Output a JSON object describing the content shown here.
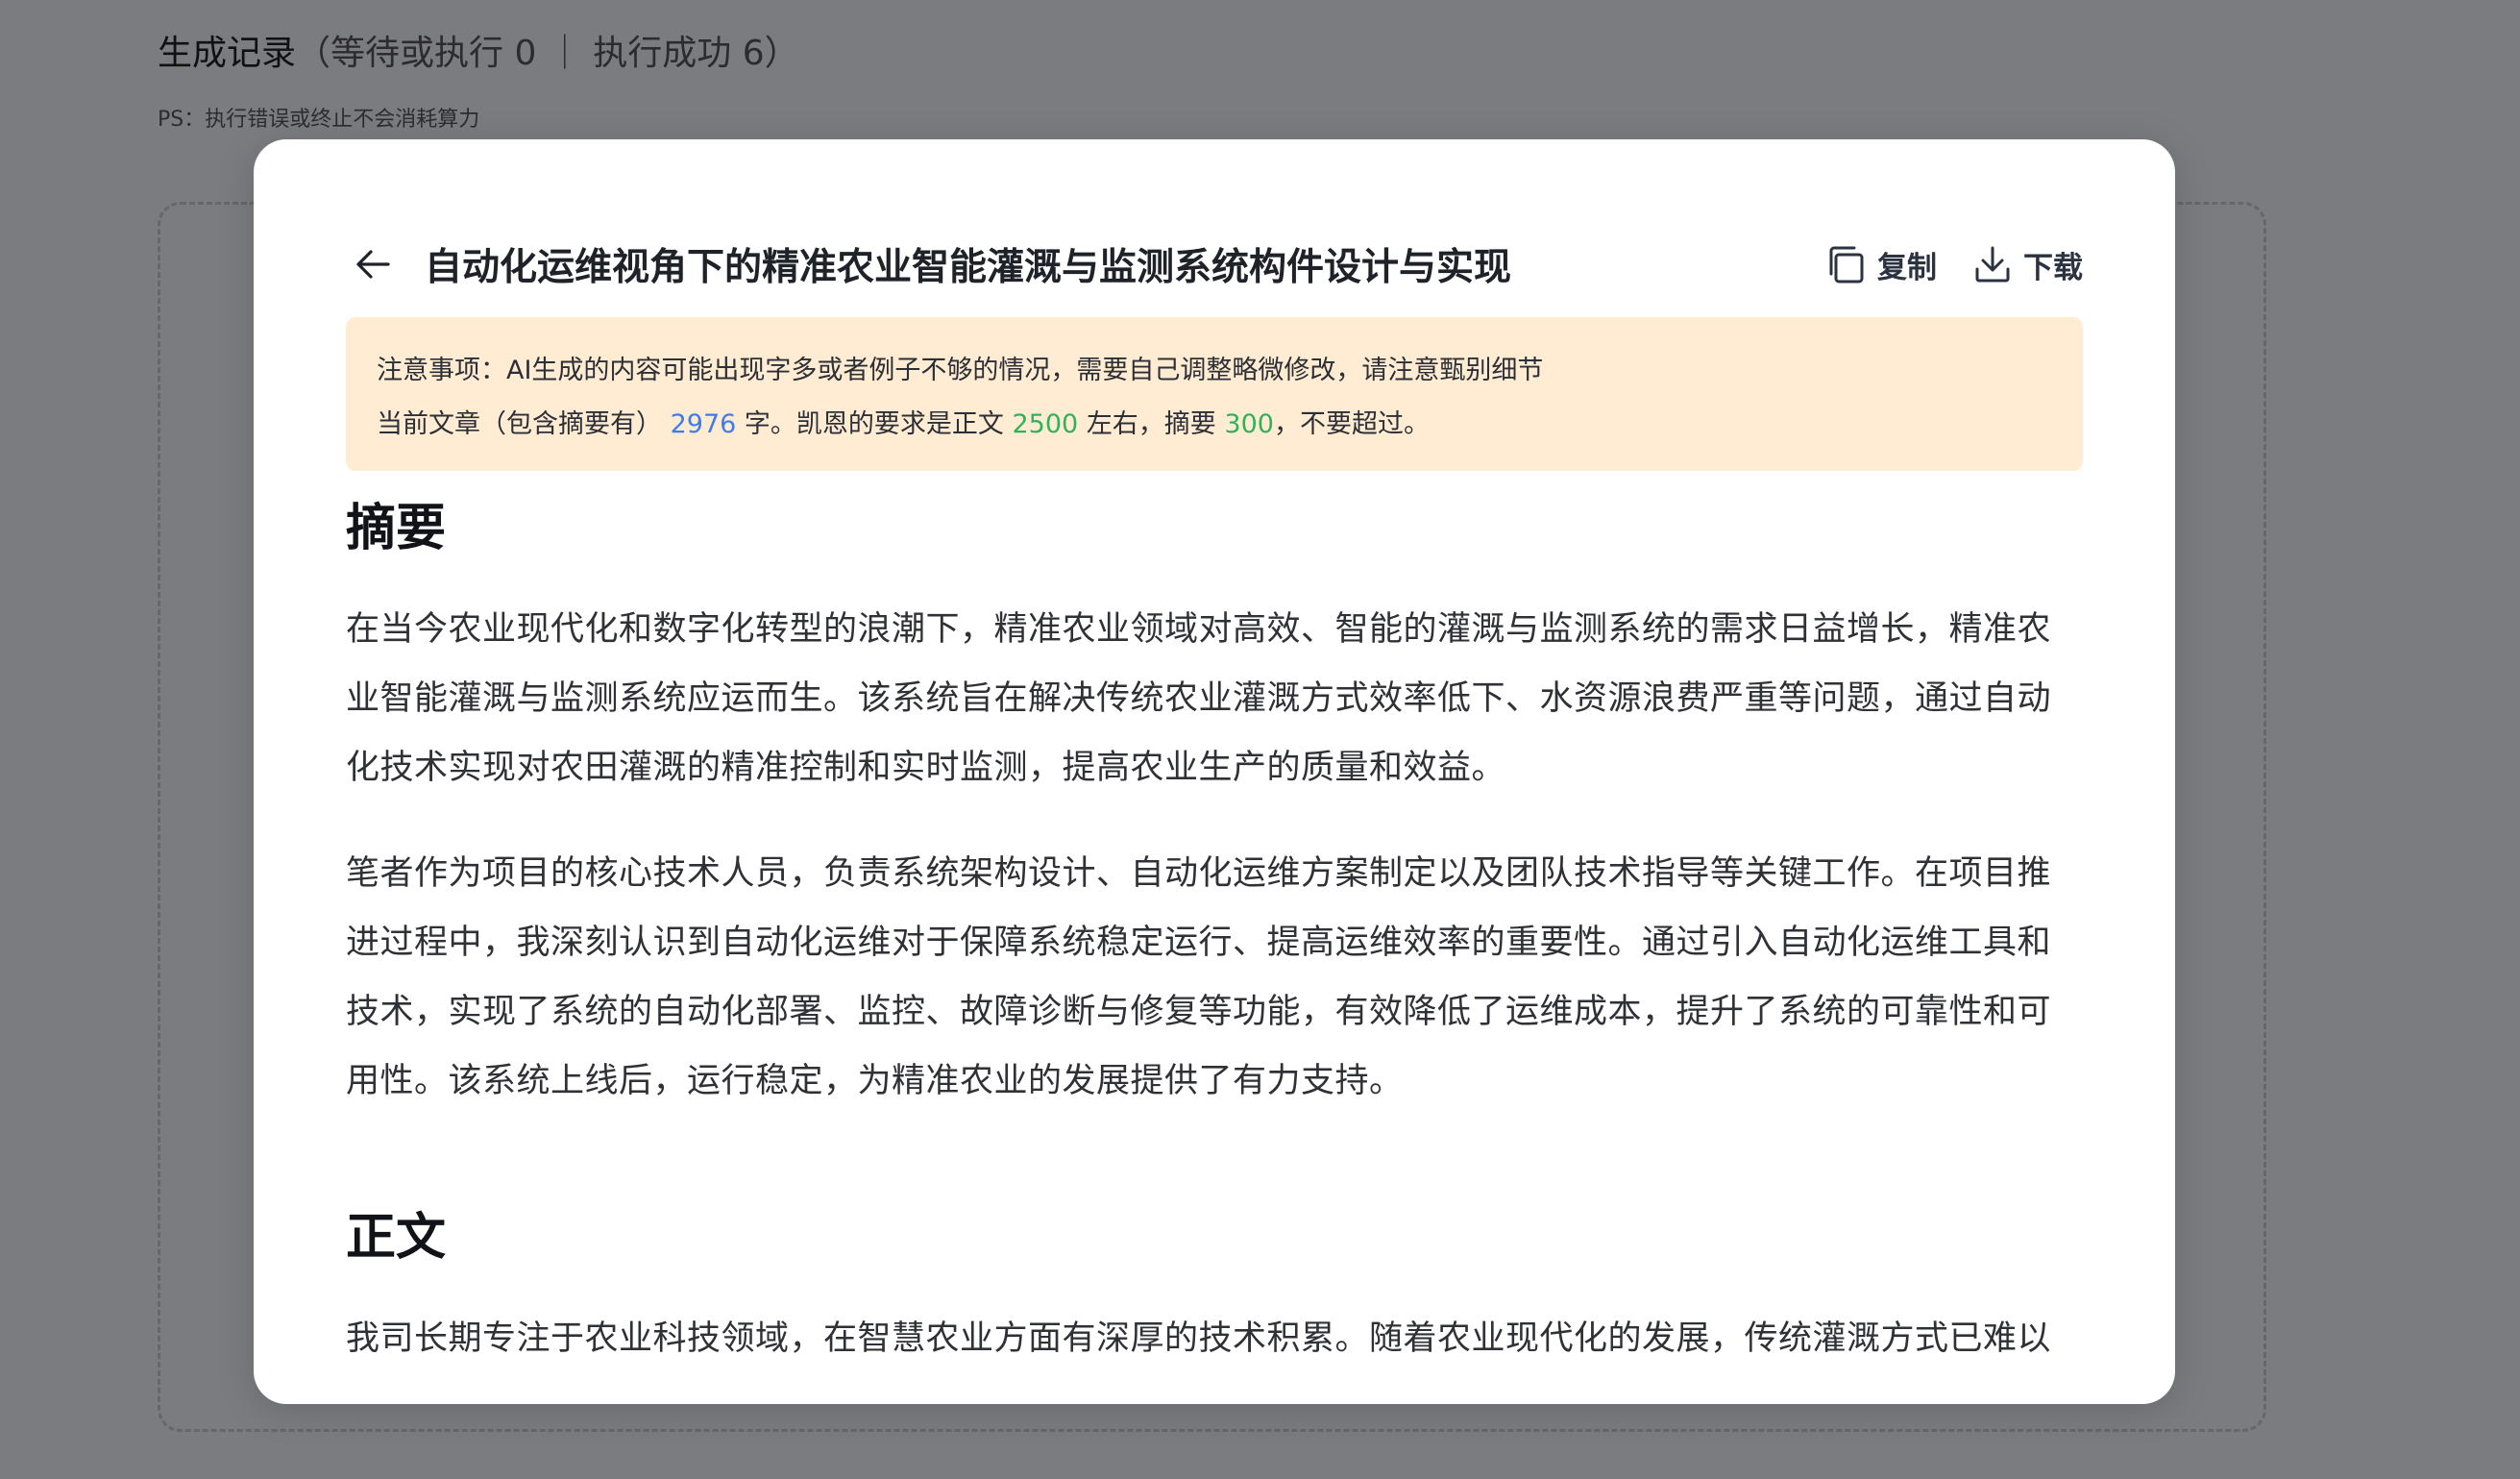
{
  "background": {
    "title": "生成记录",
    "status": "（等待或执行 0 ｜ 执行成功 6）",
    "note": "PS：执行错误或终止不会消耗算力"
  },
  "modal": {
    "title": "自动化运维视角下的精准农业智能灌溉与监测系统构件设计与实现",
    "actions": {
      "copy_label": "复制",
      "download_label": "下载"
    },
    "notice": {
      "line1": "注意事项：AI生成的内容可能出现字多或者例子不够的情况，需要自己调整略微修改，请注意甄别细节",
      "line2_prefix": "当前文章（包含摘要有）",
      "word_count": "2976",
      "line2_mid1": "字。凯恩的要求是正文",
      "body_target": "2500",
      "line2_mid2": "左右，摘要",
      "abstract_target": "300",
      "line2_suffix": "，不要超过。"
    },
    "sections": {
      "abstract_title": "摘要",
      "abstract_p1": "在当今农业现代化和数字化转型的浪潮下，精准农业领域对高效、智能的灌溉与监测系统的需求日益增长，精准农业智能灌溉与监测系统应运而生。该系统旨在解决传统农业灌溉方式效率低下、水资源浪费严重等问题，通过自动化技术实现对农田灌溉的精准控制和实时监测，提高农业生产的质量和效益。",
      "abstract_p2": "笔者作为项目的核心技术人员，负责系统架构设计、自动化运维方案制定以及团队技术指导等关键工作。在项目推进过程中，我深刻认识到自动化运维对于保障系统稳定运行、提高运维效率的重要性。通过引入自动化运维工具和技术，实现了系统的自动化部署、监控、故障诊断与修复等功能，有效降低了运维成本，提升了系统的可靠性和可用性。该系统上线后，运行稳定，为精准农业的发展提供了有力支持。",
      "body_title": "正文",
      "body_p1": "我司长期专注于农业科技领域，在智慧农业方面有深厚的技术积累。随着农业现代化的发展，传统灌溉方式已难以"
    }
  }
}
